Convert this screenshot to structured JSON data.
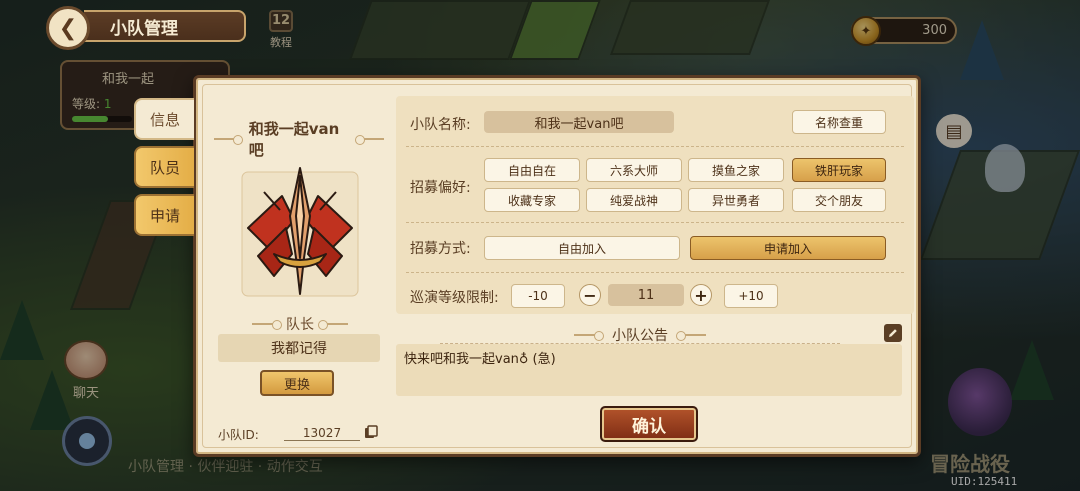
{
  "header": {
    "title": "小队管理",
    "back_icon": "back-arrow-icon",
    "tutorial_label": "教程",
    "tutorial_icon_glyph": "12",
    "coins": "300"
  },
  "team_card": {
    "name": "和我一起",
    "level_label": "等级:",
    "level_value": "1",
    "level_progress": 0.6
  },
  "tabs": [
    {
      "label": "信息",
      "active": true
    },
    {
      "label": "队员",
      "active": false
    },
    {
      "label": "申请",
      "active": false
    }
  ],
  "team": {
    "name": "和我一起van吧",
    "leader_label": "队长",
    "leader_name": "我都记得",
    "change_button": "更换",
    "id_label": "小队ID:",
    "id_value": "13027"
  },
  "form": {
    "name_label": "小队名称:",
    "name_value": "和我一起van吧",
    "name_check_button": "名称查重",
    "pref_label": "招募偏好:",
    "prefs": [
      {
        "label": "自由自在",
        "selected": false
      },
      {
        "label": "六系大师",
        "selected": false
      },
      {
        "label": "摸鱼之家",
        "selected": false
      },
      {
        "label": "铁肝玩家",
        "selected": true
      },
      {
        "label": "收藏专家",
        "selected": false
      },
      {
        "label": "纯爱战神",
        "selected": false
      },
      {
        "label": "异世勇者",
        "selected": false
      },
      {
        "label": "交个朋友",
        "selected": false
      }
    ],
    "method_label": "招募方式:",
    "methods": [
      {
        "label": "自由加入",
        "selected": false
      },
      {
        "label": "申请加入",
        "selected": true
      }
    ],
    "level_label": "巡演等级限制:",
    "minus10": "-10",
    "minus": "−",
    "level_value": "11",
    "plus": "+",
    "plus10": "+10"
  },
  "notice": {
    "title": "小队公告",
    "content": "快来吧和我一起van♁ (急)"
  },
  "confirm_button": "确认",
  "background": {
    "chat_label": "聊天",
    "bottom_hint": "小队管理 · 伙伴迎驻 · 动作交互",
    "adventure_label": "冒险战役",
    "uid": "UID:125411"
  },
  "colors": {
    "panel_bg": "#f4ead3",
    "selected_btn": "#e2b059",
    "confirm_btn": "#9a3f1f",
    "border_brown": "#5a3b24"
  }
}
